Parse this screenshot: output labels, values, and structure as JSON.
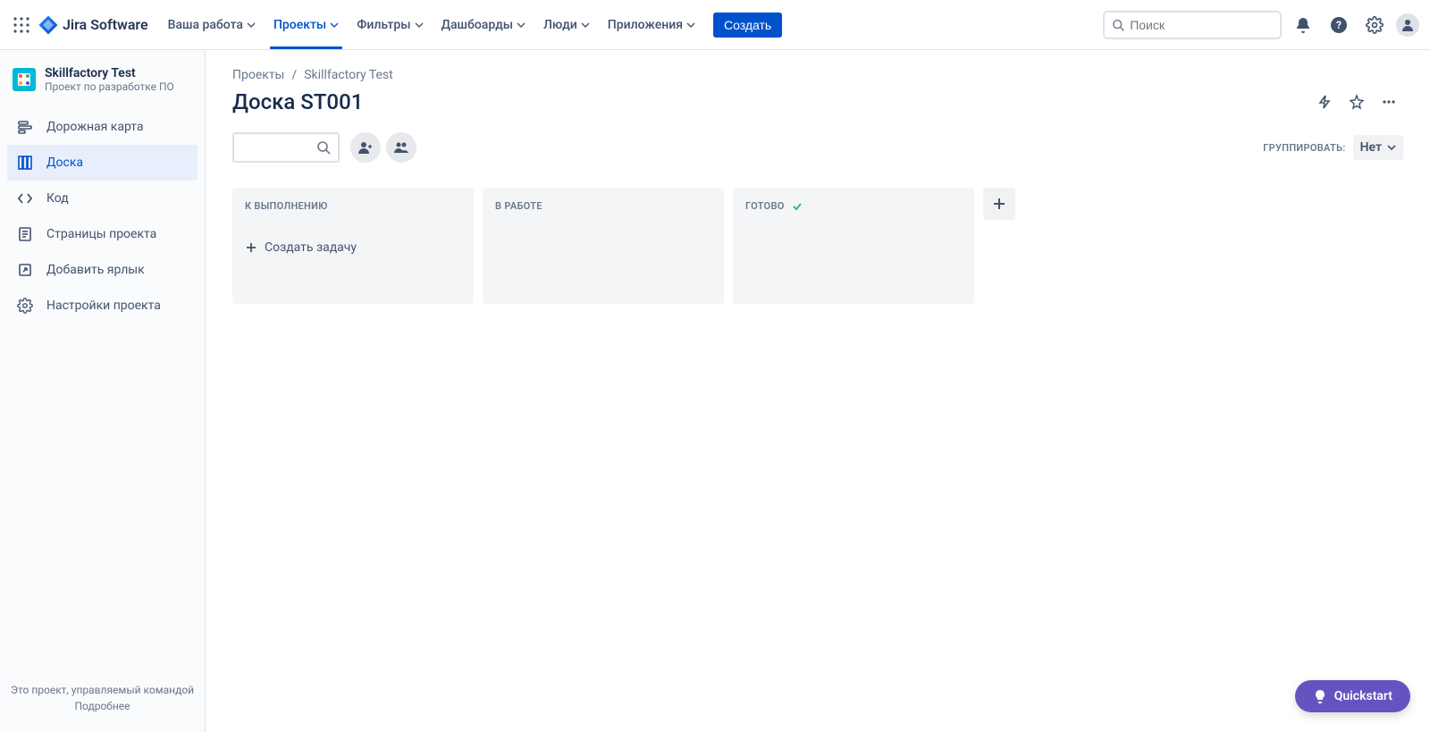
{
  "topnav": {
    "product": "Jira Software",
    "items": [
      {
        "label": "Ваша работа"
      },
      {
        "label": "Проекты",
        "active": true
      },
      {
        "label": "Фильтры"
      },
      {
        "label": "Дашбоарды"
      },
      {
        "label": "Люди"
      },
      {
        "label": "Приложения"
      }
    ],
    "create": "Создать",
    "search_placeholder": "Поиск"
  },
  "sidebar": {
    "project_name": "Skillfactory Test",
    "project_type": "Проект по разработке ПО",
    "items": [
      {
        "label": "Дорожная карта"
      },
      {
        "label": "Доска",
        "active": true
      },
      {
        "label": "Код"
      },
      {
        "label": "Страницы проекта"
      },
      {
        "label": "Добавить ярлык"
      },
      {
        "label": "Настройки проекта"
      }
    ],
    "footer_line": "Это проект, управляемый командой",
    "footer_link": "Подробнее"
  },
  "breadcrumb": {
    "root": "Проекты",
    "project": "Skillfactory Test"
  },
  "page_title": "Доска ST001",
  "group_by": {
    "label": "ГРУППИРОВАТЬ:",
    "value": "Нет"
  },
  "columns": [
    {
      "title": "К ВЫПОЛНЕНИЮ",
      "has_create": true
    },
    {
      "title": "В РАБОТЕ"
    },
    {
      "title": "ГОТОВО",
      "done": true
    }
  ],
  "create_issue": "Создать задачу",
  "quickstart": "Quickstart"
}
